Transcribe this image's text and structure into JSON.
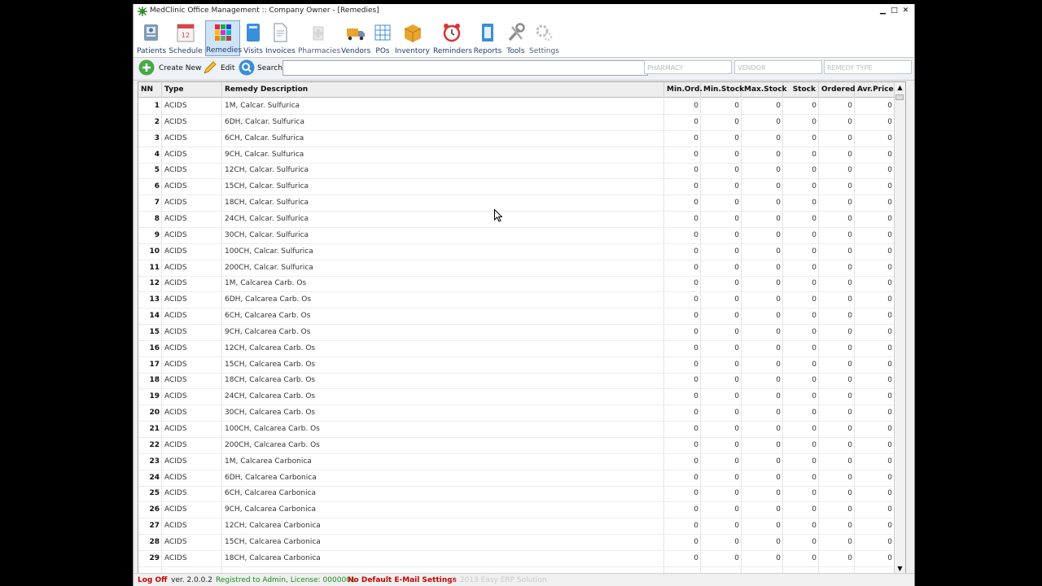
{
  "window": {
    "title": "MedClinic Office Management :: Company Owner - [Remedies]",
    "controls": {
      "minimize": "▁",
      "maximize": "□",
      "close": "✕"
    }
  },
  "toolbar": {
    "items": [
      {
        "label": "Patients",
        "icon": "patients-icon"
      },
      {
        "label": "Schedule",
        "icon": "schedule-icon"
      },
      {
        "label": "Remedies",
        "icon": "remedies-icon",
        "active": true
      },
      {
        "label": "Visits",
        "icon": "visits-icon"
      },
      {
        "label": "Invoices",
        "icon": "invoices-icon"
      },
      {
        "label": "Pharmacies",
        "icon": "pharmacies-icon"
      },
      {
        "label": "Vendors",
        "icon": "vendors-icon"
      },
      {
        "label": "POs",
        "icon": "pos-icon"
      },
      {
        "label": "Inventory",
        "icon": "inventory-icon"
      },
      {
        "label": "Reminders",
        "icon": "reminders-icon"
      },
      {
        "label": "Reports",
        "icon": "reports-icon"
      },
      {
        "label": "Tools",
        "icon": "tools-icon"
      },
      {
        "label": "Settings",
        "icon": "settings-icon"
      }
    ]
  },
  "actions": {
    "create_label": "Create New",
    "edit_label": "Edit",
    "search_label": "Search",
    "search_value": "",
    "filters": {
      "pharmacy": "PHARMACY",
      "vendor": "VENDOR",
      "remedy_type": "REMEDY TYPE"
    }
  },
  "grid": {
    "columns": [
      "NN",
      "Type",
      "Remedy Description",
      "Min.Ord.",
      "Min.Stock",
      "Max.Stock",
      "Stock",
      "Ordered",
      "Avr.Price"
    ],
    "rows": [
      {
        "nn": "1",
        "type": "ACIDS",
        "desc": "1M, Calcar. Sulfurica",
        "min_ord": "0",
        "min_stock": "0",
        "max_stock": "0",
        "stock": "0",
        "ordered": "0",
        "avr_price": "0"
      },
      {
        "nn": "2",
        "type": "ACIDS",
        "desc": "6DH, Calcar. Sulfurica",
        "min_ord": "0",
        "min_stock": "0",
        "max_stock": "0",
        "stock": "0",
        "ordered": "0",
        "avr_price": "0"
      },
      {
        "nn": "3",
        "type": "ACIDS",
        "desc": "6CH, Calcar. Sulfurica",
        "min_ord": "0",
        "min_stock": "0",
        "max_stock": "0",
        "stock": "0",
        "ordered": "0",
        "avr_price": "0"
      },
      {
        "nn": "4",
        "type": "ACIDS",
        "desc": "9CH, Calcar. Sulfurica",
        "min_ord": "0",
        "min_stock": "0",
        "max_stock": "0",
        "stock": "0",
        "ordered": "0",
        "avr_price": "0"
      },
      {
        "nn": "5",
        "type": "ACIDS",
        "desc": "12CH, Calcar. Sulfurica",
        "min_ord": "0",
        "min_stock": "0",
        "max_stock": "0",
        "stock": "0",
        "ordered": "0",
        "avr_price": "0"
      },
      {
        "nn": "6",
        "type": "ACIDS",
        "desc": "15CH, Calcar. Sulfurica",
        "min_ord": "0",
        "min_stock": "0",
        "max_stock": "0",
        "stock": "0",
        "ordered": "0",
        "avr_price": "0"
      },
      {
        "nn": "7",
        "type": "ACIDS",
        "desc": "18CH, Calcar. Sulfurica",
        "min_ord": "0",
        "min_stock": "0",
        "max_stock": "0",
        "stock": "0",
        "ordered": "0",
        "avr_price": "0"
      },
      {
        "nn": "8",
        "type": "ACIDS",
        "desc": "24CH, Calcar. Sulfurica",
        "min_ord": "0",
        "min_stock": "0",
        "max_stock": "0",
        "stock": "0",
        "ordered": "0",
        "avr_price": "0"
      },
      {
        "nn": "9",
        "type": "ACIDS",
        "desc": "30CH, Calcar. Sulfurica",
        "min_ord": "0",
        "min_stock": "0",
        "max_stock": "0",
        "stock": "0",
        "ordered": "0",
        "avr_price": "0"
      },
      {
        "nn": "10",
        "type": "ACIDS",
        "desc": "100CH, Calcar. Sulfurica",
        "min_ord": "0",
        "min_stock": "0",
        "max_stock": "0",
        "stock": "0",
        "ordered": "0",
        "avr_price": "0"
      },
      {
        "nn": "11",
        "type": "ACIDS",
        "desc": "200CH, Calcar. Sulfurica",
        "min_ord": "0",
        "min_stock": "0",
        "max_stock": "0",
        "stock": "0",
        "ordered": "0",
        "avr_price": "0"
      },
      {
        "nn": "12",
        "type": "ACIDS",
        "desc": "1M, Calcarea Carb. Os",
        "min_ord": "0",
        "min_stock": "0",
        "max_stock": "0",
        "stock": "0",
        "ordered": "0",
        "avr_price": "0"
      },
      {
        "nn": "13",
        "type": "ACIDS",
        "desc": "6DH, Calcarea Carb. Os",
        "min_ord": "0",
        "min_stock": "0",
        "max_stock": "0",
        "stock": "0",
        "ordered": "0",
        "avr_price": "0"
      },
      {
        "nn": "14",
        "type": "ACIDS",
        "desc": "6CH, Calcarea Carb. Os",
        "min_ord": "0",
        "min_stock": "0",
        "max_stock": "0",
        "stock": "0",
        "ordered": "0",
        "avr_price": "0"
      },
      {
        "nn": "15",
        "type": "ACIDS",
        "desc": "9CH, Calcarea Carb. Os",
        "min_ord": "0",
        "min_stock": "0",
        "max_stock": "0",
        "stock": "0",
        "ordered": "0",
        "avr_price": "0"
      },
      {
        "nn": "16",
        "type": "ACIDS",
        "desc": "12CH, Calcarea Carb. Os",
        "min_ord": "0",
        "min_stock": "0",
        "max_stock": "0",
        "stock": "0",
        "ordered": "0",
        "avr_price": "0"
      },
      {
        "nn": "17",
        "type": "ACIDS",
        "desc": "15CH, Calcarea Carb. Os",
        "min_ord": "0",
        "min_stock": "0",
        "max_stock": "0",
        "stock": "0",
        "ordered": "0",
        "avr_price": "0"
      },
      {
        "nn": "18",
        "type": "ACIDS",
        "desc": "18CH, Calcarea Carb. Os",
        "min_ord": "0",
        "min_stock": "0",
        "max_stock": "0",
        "stock": "0",
        "ordered": "0",
        "avr_price": "0"
      },
      {
        "nn": "19",
        "type": "ACIDS",
        "desc": "24CH, Calcarea Carb. Os",
        "min_ord": "0",
        "min_stock": "0",
        "max_stock": "0",
        "stock": "0",
        "ordered": "0",
        "avr_price": "0"
      },
      {
        "nn": "20",
        "type": "ACIDS",
        "desc": "30CH, Calcarea Carb. Os",
        "min_ord": "0",
        "min_stock": "0",
        "max_stock": "0",
        "stock": "0",
        "ordered": "0",
        "avr_price": "0"
      },
      {
        "nn": "21",
        "type": "ACIDS",
        "desc": "100CH, Calcarea Carb. Os",
        "min_ord": "0",
        "min_stock": "0",
        "max_stock": "0",
        "stock": "0",
        "ordered": "0",
        "avr_price": "0"
      },
      {
        "nn": "22",
        "type": "ACIDS",
        "desc": "200CH, Calcarea Carb. Os",
        "min_ord": "0",
        "min_stock": "0",
        "max_stock": "0",
        "stock": "0",
        "ordered": "0",
        "avr_price": "0"
      },
      {
        "nn": "23",
        "type": "ACIDS",
        "desc": "1M, Calcarea Carbonica",
        "min_ord": "0",
        "min_stock": "0",
        "max_stock": "0",
        "stock": "0",
        "ordered": "0",
        "avr_price": "0"
      },
      {
        "nn": "24",
        "type": "ACIDS",
        "desc": "6DH, Calcarea Carbonica",
        "min_ord": "0",
        "min_stock": "0",
        "max_stock": "0",
        "stock": "0",
        "ordered": "0",
        "avr_price": "0"
      },
      {
        "nn": "25",
        "type": "ACIDS",
        "desc": "6CH, Calcarea Carbonica",
        "min_ord": "0",
        "min_stock": "0",
        "max_stock": "0",
        "stock": "0",
        "ordered": "0",
        "avr_price": "0"
      },
      {
        "nn": "26",
        "type": "ACIDS",
        "desc": "9CH, Calcarea Carbonica",
        "min_ord": "0",
        "min_stock": "0",
        "max_stock": "0",
        "stock": "0",
        "ordered": "0",
        "avr_price": "0"
      },
      {
        "nn": "27",
        "type": "ACIDS",
        "desc": "12CH, Calcarea Carbonica",
        "min_ord": "0",
        "min_stock": "0",
        "max_stock": "0",
        "stock": "0",
        "ordered": "0",
        "avr_price": "0"
      },
      {
        "nn": "28",
        "type": "ACIDS",
        "desc": "15CH, Calcarea Carbonica",
        "min_ord": "0",
        "min_stock": "0",
        "max_stock": "0",
        "stock": "0",
        "ordered": "0",
        "avr_price": "0"
      },
      {
        "nn": "29",
        "type": "ACIDS",
        "desc": "18CH, Calcarea Carbonica",
        "min_ord": "0",
        "min_stock": "0",
        "max_stock": "0",
        "stock": "0",
        "ordered": "0",
        "avr_price": "0"
      }
    ]
  },
  "status": {
    "logoff": "Log Off",
    "version": "ver. 2.0.0.2",
    "registration": "Registred to Admin, License: 0000001",
    "email_warning": "No Default E-Mail Settings",
    "copyright": "© 2013 Easy ERP Solution"
  },
  "colors": {
    "accent": "#1f3c6e",
    "status_green": "#1a8a1a",
    "status_red": "#cc0000",
    "active_tool": "#cfe3f7"
  }
}
